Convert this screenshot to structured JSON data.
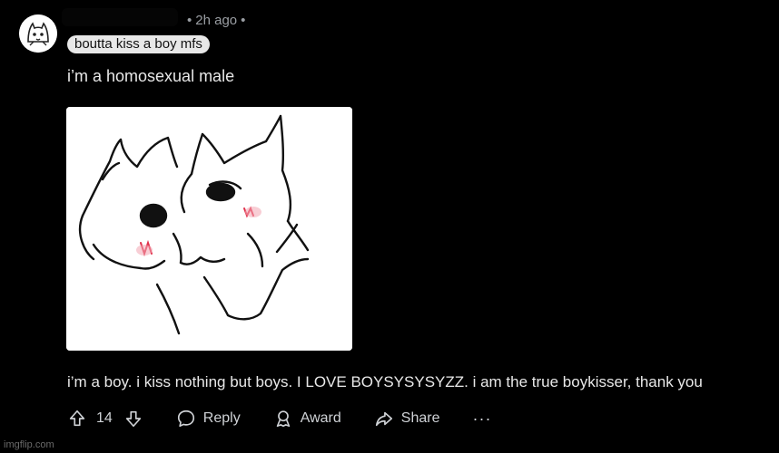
{
  "post": {
    "time_ago": "2h ago",
    "flair": "boutta kiss a boy mfs",
    "title": "i’m a homosexual male",
    "body": "i’m a boy. i kiss nothing but boys. I LOVE BOYSYSYSYZZ. i am the true boykisser, thank you"
  },
  "actions": {
    "vote_count": "14",
    "reply_label": "Reply",
    "award_label": "Award",
    "share_label": "Share",
    "more_label": "···"
  },
  "watermark": "imgflip.com",
  "colors": {
    "background": "#000000",
    "text": "#e8e8e8",
    "muted": "#9a9ea3",
    "flair_bg": "#e8e8e8",
    "blush": "#e0304a"
  },
  "icons": {
    "upvote": "arrow-up-icon",
    "downvote": "arrow-down-icon",
    "reply": "speech-bubble-icon",
    "award": "award-ribbon-icon",
    "share": "share-arrow-icon"
  }
}
